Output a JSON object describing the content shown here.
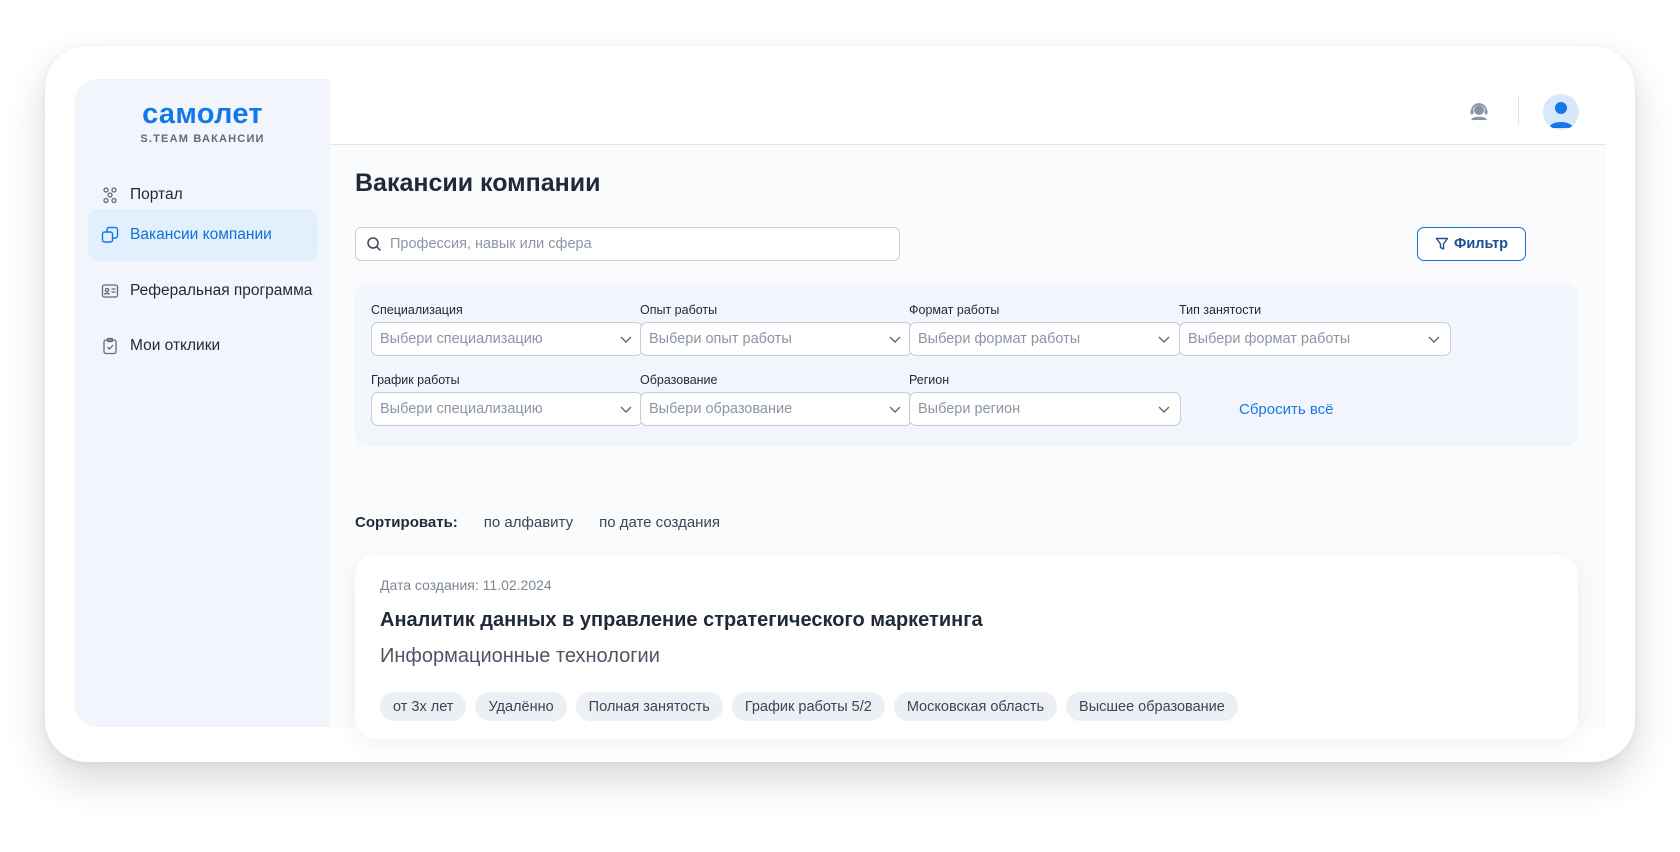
{
  "brand": {
    "logo": "самолет",
    "subtitle": "S.TEAM ВАКАНСИИ",
    "accent_color": "#1478e8"
  },
  "sidebar": {
    "items": [
      {
        "label": "Портал",
        "icon": "people-network-icon",
        "active": false
      },
      {
        "label": "Вакансии компании",
        "icon": "copy-cards-icon",
        "active": true
      },
      {
        "label": "Реферальная программа",
        "icon": "id-card-icon",
        "active": false
      },
      {
        "label": "Мои отклики",
        "icon": "clipboard-check-icon",
        "active": false
      }
    ]
  },
  "header": {
    "support_icon": "headset-support-icon",
    "avatar_icon": "user-avatar-icon"
  },
  "main": {
    "title": "Вакансии компании",
    "search": {
      "placeholder": "Профессия, навык или сфера",
      "value": ""
    },
    "filter_button": "Фильтр",
    "filters": {
      "specialization": {
        "label": "Специализация",
        "placeholder": "Выбери специализацию"
      },
      "experience": {
        "label": "Опыт работы",
        "placeholder": "Выбери опыт работы"
      },
      "format": {
        "label": "Формат работы",
        "placeholder": "Выбери формат работы"
      },
      "employment": {
        "label": "Тип занятости",
        "placeholder": "Выбери формат работы"
      },
      "schedule": {
        "label": "График работы",
        "placeholder": "Выбери специализацию"
      },
      "education": {
        "label": "Образование",
        "placeholder": "Выбери образование"
      },
      "region": {
        "label": "Регион",
        "placeholder": "Выбери регион"
      },
      "reset": "Сбросить всё"
    },
    "sort": {
      "label": "Сортировать:",
      "options": [
        "по алфавиту",
        "по дате создания"
      ]
    },
    "vacancy": {
      "date": "Дата создания: 11.02.2024",
      "title": "Аналитик данных в управление стратегического маркетинга",
      "department": "Информационные технологии",
      "tags": [
        "от 3х лет",
        "Удалённо",
        "Полная занятость",
        "График работы 5/2",
        "Московская область",
        "Высшее образование"
      ]
    }
  }
}
